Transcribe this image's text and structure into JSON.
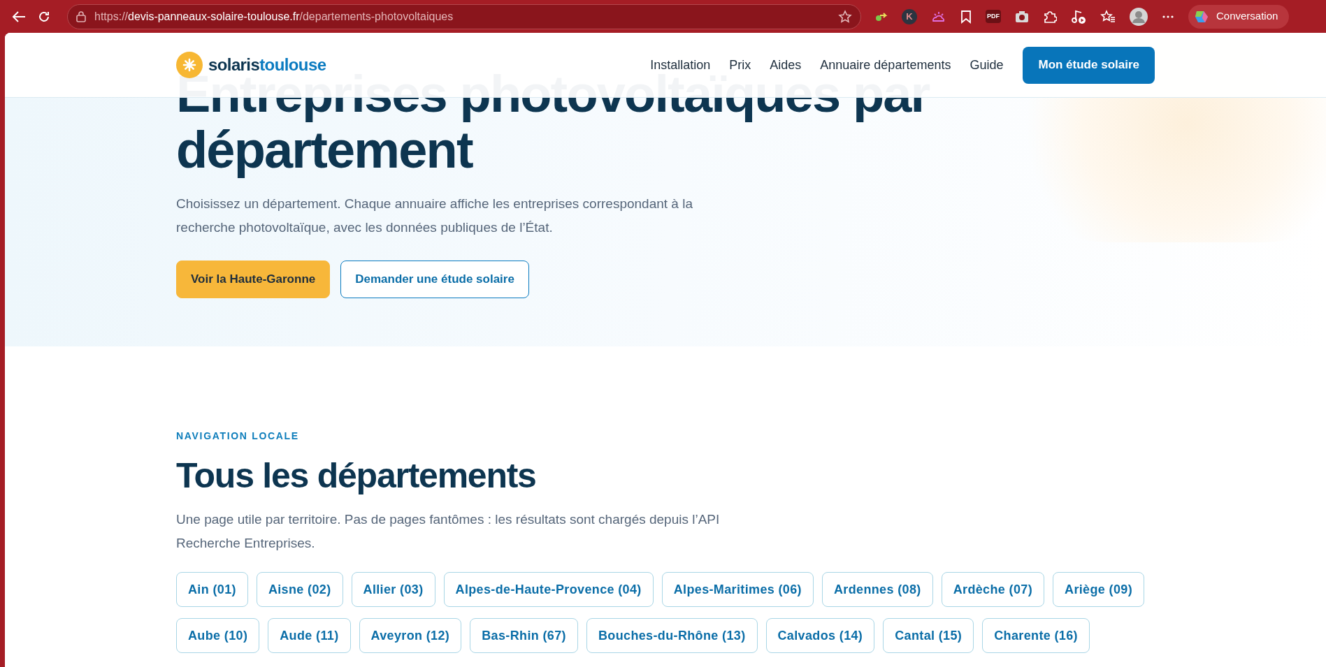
{
  "browser": {
    "url": {
      "scheme": "https://",
      "host": "devis-panneaux-solaire-toulouse.fr",
      "path": "/departements-photovoltaiques"
    },
    "extension_letter": "K",
    "pdf_label": "PDF",
    "copilot_label": "Conversation"
  },
  "header": {
    "logo": {
      "first": "solaris",
      "second": "toulouse"
    },
    "nav": [
      "Installation",
      "Prix",
      "Aides",
      "Annuaire départements",
      "Guide"
    ],
    "cta": "Mon étude solaire"
  },
  "hero": {
    "title_lines": [
      "Entreprises photovoltaïques par",
      "département"
    ],
    "text": "Choisissez un département. Chaque annuaire affiche les entreprises correspondant à la recherche photovoltaïque, avec les données publiques de l’État.",
    "buttons": [
      {
        "label": "Voir la Haute-Garonne",
        "kind": "primary"
      },
      {
        "label": "Demander une étude solaire",
        "kind": "outline"
      }
    ]
  },
  "departments": {
    "eyebrow": "NAVIGATION LOCALE",
    "title": "Tous les départements",
    "text": "Une page utile par territoire. Pas de pages fantômes : les résultats sont chargés depuis l’API Recherche Entreprises.",
    "items": [
      "Ain (01)",
      "Aisne (02)",
      "Allier (03)",
      "Alpes-de-Haute-Provence (04)",
      "Alpes-Maritimes (06)",
      "Ardennes (08)",
      "Ardèche (07)",
      "Ariège (09)",
      "Aube (10)",
      "Aude (11)",
      "Aveyron (12)",
      "Bas-Rhin (67)",
      "Bouches-du-Rhône (13)",
      "Calvados (14)",
      "Cantal (15)",
      "Charente (16)"
    ]
  }
}
